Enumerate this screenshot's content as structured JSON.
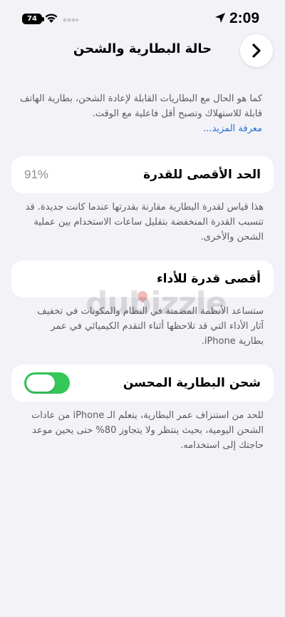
{
  "status_bar": {
    "battery_level": "74",
    "time": "2:09",
    "wifi_icon": "wifi-icon",
    "signal_icon": "cellular-signal-icon",
    "location_icon": "location-arrow-icon"
  },
  "nav": {
    "title": "حالة البطارية والشحن",
    "back_icon": "chevron-right-icon"
  },
  "intro": {
    "text": "كما هو الحال مع البطاريات القابلة لإعادة الشحن، بطارية الهاتف قابلة للاستهلاك وتصبح أقل فاعلية مع الوقت.",
    "link": "معرفة المزيد..."
  },
  "max_capacity": {
    "label": "الحد الأقصى للقدرة",
    "value": "91%",
    "note": "هذا قياس لقدرة البطارية مقارنة بقدرتها عندما كانت جديدة. قد تتسبب القدرة المنخفضة بتقليل ساعات الاستخدام بين عملية الشحن والأخرى."
  },
  "peak_performance": {
    "label": "أقصى قدرة للأداء",
    "note": "ستساعد الأنظمة المضمنة في النظام والمكونات في تخفيف آثار الأداء التي قد تلاحظها أثناء التقدم الكيميائي في عمر بطارية iPhone."
  },
  "optimized_charging": {
    "label": "شحن البطارية المحسن",
    "enabled": true,
    "note": "للحد من استنزاف عمر البطارية، يتعلم الـ iPhone من عادات الشحن اليومية، بحيث ينتظر ولا يتجاوز 80% حتى يحين موعد حاجتك إلى استخدامه."
  },
  "watermark": "dubizzle",
  "colors": {
    "background": "#f2f2f7",
    "toggle_on": "#34c759",
    "link": "#2a6fd6"
  }
}
